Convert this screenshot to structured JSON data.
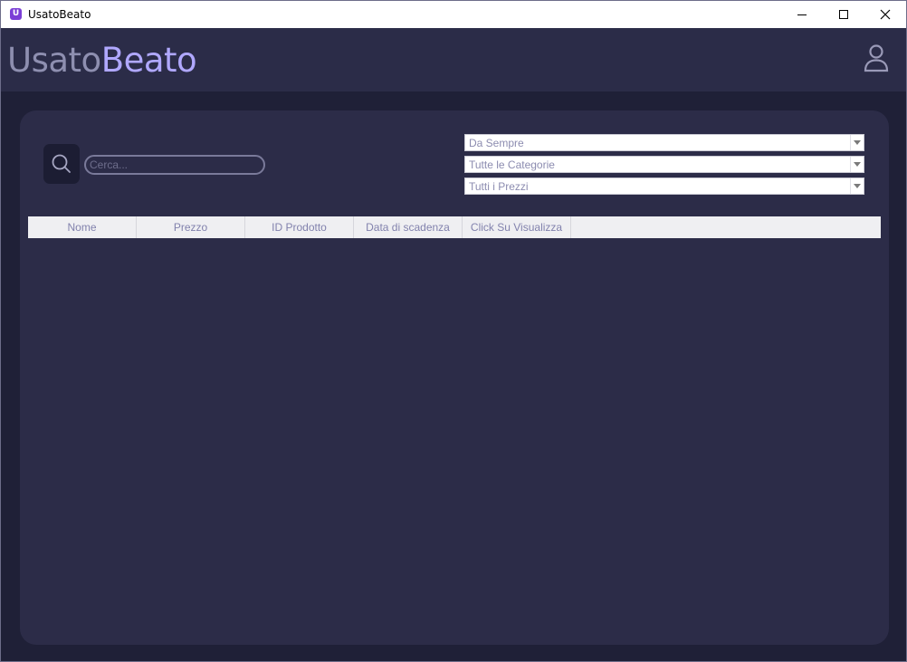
{
  "window": {
    "title": "UsatoBeato",
    "icon_letter": "U"
  },
  "header": {
    "logo_part1": "Usato",
    "logo_part2": "Beato"
  },
  "search": {
    "placeholder": "Cerca..."
  },
  "filters": {
    "date": "Da Sempre",
    "category": "Tutte le Categorie",
    "price": "Tutti i Prezzi"
  },
  "table": {
    "columns": [
      "Nome",
      "Prezzo",
      "ID Prodotto",
      "Data di scadenza",
      "Click Su Visualizza"
    ],
    "rows": []
  },
  "colors": {
    "background": "#1f2037",
    "panel": "#2c2c48",
    "logo_primary": "#8e8fb0",
    "logo_accent": "#b0a8ff",
    "app_icon": "#7b3fd6"
  }
}
